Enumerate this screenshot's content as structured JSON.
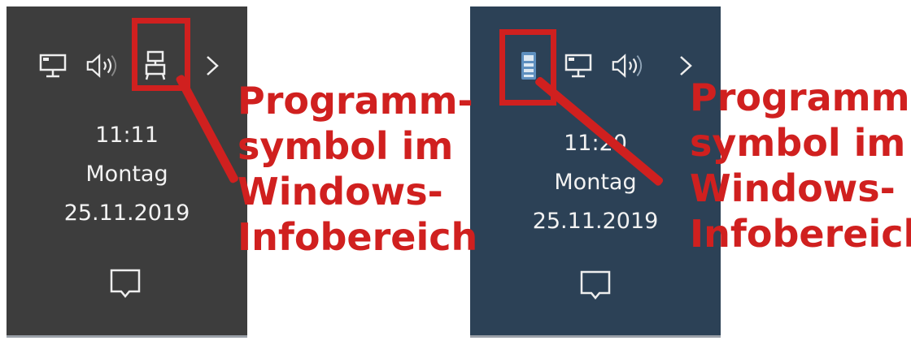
{
  "left_panel": {
    "clock_time": "11:11",
    "clock_day": "Montag",
    "clock_date": "25.11.2019",
    "tray_icons": [
      "network-icon",
      "volume-icon",
      "program-icon",
      "chevron-right-icon"
    ],
    "background": "#3d3d3d"
  },
  "right_panel": {
    "clock_time": "11:20",
    "clock_day": "Montag",
    "clock_date": "25.11.2019",
    "tray_icons": [
      "program-icon",
      "network-icon",
      "volume-icon",
      "chevron-right-icon"
    ],
    "background": "#2c4156"
  },
  "annotation": {
    "line1": "Programm-",
    "line2": "symbol im",
    "line3": "Windows-",
    "line4": "Infobereich",
    "color": "#d0201f"
  }
}
